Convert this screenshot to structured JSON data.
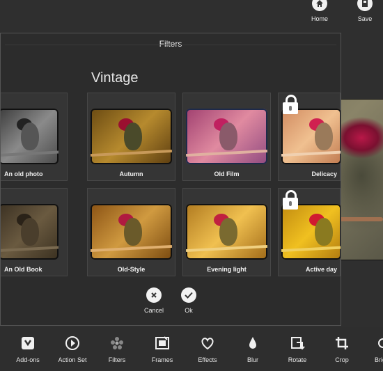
{
  "top_actions": {
    "home_label": "Home",
    "save_label": "Save"
  },
  "dialog": {
    "title": "Filters",
    "category": "Vintage",
    "filters": [
      {
        "label": "An old photo",
        "icon": "grayscale-thumb"
      },
      {
        "label": "Autumn",
        "icon": "autumn-thumb"
      },
      {
        "label": "Old Film",
        "icon": "oldfilm-thumb"
      },
      {
        "label": "Delicacy",
        "icon": "delicacy-thumb",
        "locked": true
      },
      {
        "label": "An Old Book",
        "icon": "oldbook-thumb"
      },
      {
        "label": "Old-Style",
        "icon": "oldstyle-thumb"
      },
      {
        "label": "Evening light",
        "icon": "evening-thumb"
      },
      {
        "label": "Active day",
        "icon": "activeday-thumb",
        "locked": true
      }
    ],
    "cancel_label": "Cancel",
    "ok_label": "Ok"
  },
  "toolbar": {
    "items": [
      {
        "label": "Add-ons",
        "icon": "addons-icon"
      },
      {
        "label": "Action Set",
        "icon": "play-icon"
      },
      {
        "label": "Filters",
        "icon": "filters-icon"
      },
      {
        "label": "Frames",
        "icon": "frames-icon"
      },
      {
        "label": "Effects",
        "icon": "effects-icon"
      },
      {
        "label": "Blur",
        "icon": "drop-icon"
      },
      {
        "label": "Rotate",
        "icon": "rotate-icon"
      },
      {
        "label": "Crop",
        "icon": "crop-icon"
      },
      {
        "label": "Brig",
        "icon": "brightness-icon"
      }
    ]
  }
}
